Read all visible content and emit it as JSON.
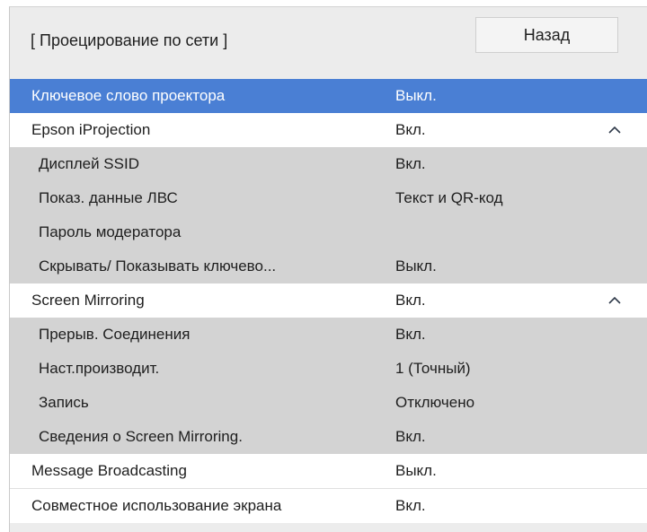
{
  "header": {
    "title": "[ Проецирование по сети ]",
    "back_label": "Назад"
  },
  "menu": {
    "rows": [
      {
        "label": "Ключевое слово проектора",
        "value": "Выкл.",
        "kind": "selected"
      },
      {
        "label": "Epson iProjection",
        "value": "Вкл.",
        "kind": "section",
        "expanded": true
      },
      {
        "label": "Дисплей SSID",
        "value": "Вкл.",
        "kind": "sub"
      },
      {
        "label": "Показ. данные ЛВС",
        "value": "Текст и QR-код",
        "kind": "sub"
      },
      {
        "label": "Пароль модератора",
        "value": "",
        "kind": "sub"
      },
      {
        "label": "Скрывать/ Показывать ключево...",
        "value": "Выкл.",
        "kind": "sub"
      },
      {
        "label": "Screen Mirroring",
        "value": "Вкл.",
        "kind": "section",
        "expanded": true
      },
      {
        "label": "Прерыв. Соединения",
        "value": "Вкл.",
        "kind": "sub"
      },
      {
        "label": "Наст.производит.",
        "value": "1 (Точный)",
        "kind": "sub"
      },
      {
        "label": "Запись",
        "value": "Отключено",
        "kind": "sub"
      },
      {
        "label": "Сведения о Screen Mirroring.",
        "value": "Вкл.",
        "kind": "sub"
      },
      {
        "label": "Message Broadcasting",
        "value": "Выкл.",
        "kind": "section"
      },
      {
        "label": "Совместное использование экрана",
        "value": "Вкл.",
        "kind": "section"
      }
    ]
  },
  "colors": {
    "selected": "#4a7fd4",
    "section": "#ffffff",
    "sub": "#d3d3d3",
    "panel": "#ececec"
  },
  "icons": {
    "expand": "chevron-up-icon"
  }
}
